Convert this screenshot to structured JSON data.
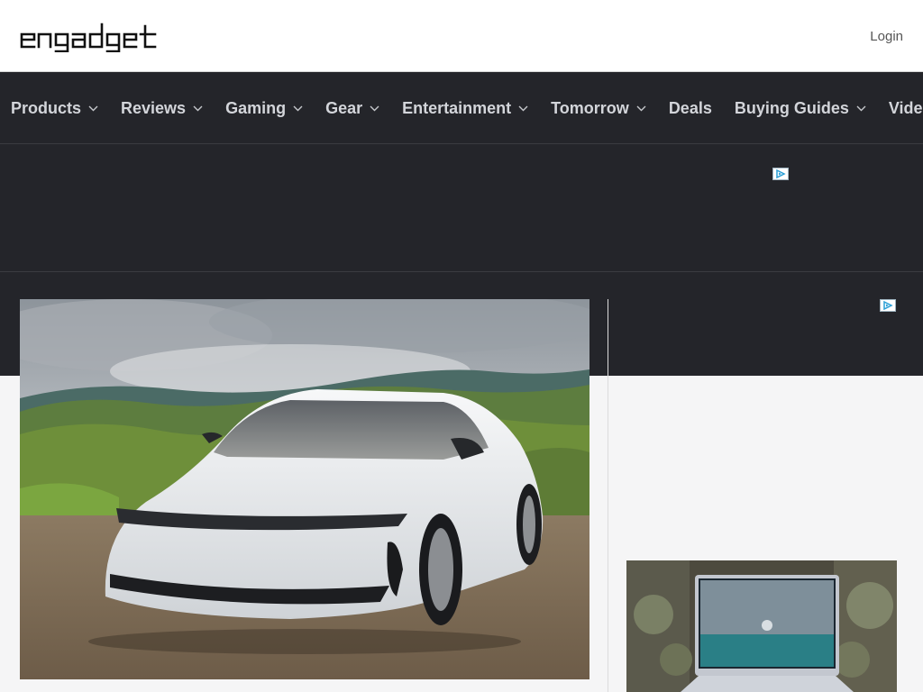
{
  "header": {
    "logo_text": "engadget",
    "login_label": "Login"
  },
  "nav": {
    "items": [
      {
        "label": "Products",
        "has_dropdown": true
      },
      {
        "label": "Reviews",
        "has_dropdown": true
      },
      {
        "label": "Gaming",
        "has_dropdown": true
      },
      {
        "label": "Gear",
        "has_dropdown": true
      },
      {
        "label": "Entertainment",
        "has_dropdown": true
      },
      {
        "label": "Tomorrow",
        "has_dropdown": true
      },
      {
        "label": "Deals",
        "has_dropdown": false
      },
      {
        "label": "Buying Guides",
        "has_dropdown": true
      },
      {
        "label": "Video",
        "has_dropdown": false
      }
    ]
  },
  "ads": {
    "marker_icon": "ad-choices-icon"
  },
  "colors": {
    "nav_bg": "#24252a",
    "nav_text": "#d3d5da",
    "page_bg": "#f5f5f6"
  }
}
